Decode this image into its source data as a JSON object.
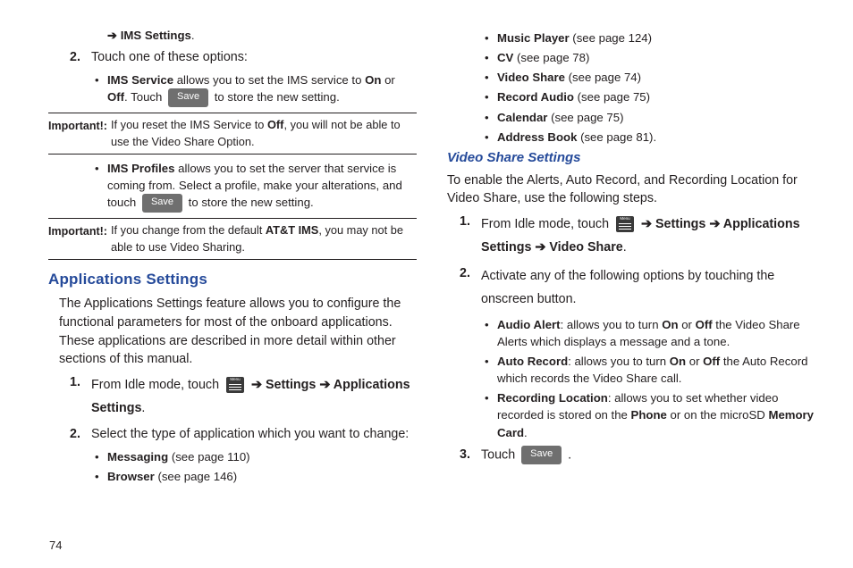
{
  "pageNumber": "74",
  "left": {
    "line1_pre": "➔ ",
    "line1_bold": "IMS Settings",
    "line1_post": ".",
    "step2_num": "2.",
    "step2_text": "Touch one of these options:",
    "b1_a": "IMS Service",
    "b1_b": " allows you to set the IMS service to ",
    "b1_c": "On",
    "b1_d": " or ",
    "b1_e": "Off",
    "b1_f": ". Touch ",
    "b1_save": "Save",
    "b1_g": " to store the new setting.",
    "imp1_label": "Important!:",
    "imp1_a": "If you reset the IMS Service to ",
    "imp1_b": "Off",
    "imp1_c": ", you will not be able to use the Video Share Option.",
    "b2_a": "IMS Profiles",
    "b2_b": " allows you to set the server that service is coming from. Select a profile, make your alterations, and touch ",
    "b2_save": "Save",
    "b2_c": " to store the new setting.",
    "imp2_label": "Important!:",
    "imp2_a": "If you change from the default ",
    "imp2_b": "AT&T IMS",
    "imp2_c": ", you may not be able to use Video Sharing.",
    "appset_head": "Applications Settings",
    "appset_para": "The Applications Settings feature allows you to configure the functional parameters for most of the onboard applications. These applications are described in more detail within other sections of this manual.",
    "as1_num": "1.",
    "as1_a": "From Idle mode, touch ",
    "as1_b": " ➔ ",
    "as1_c": "Settings",
    "as1_d": " ➔ ",
    "as1_e": "Applications Settings",
    "as1_f": ".",
    "as2_num": "2.",
    "as2_text": "Select the type of application which you want to change:",
    "list1_a": "Messaging",
    "list1_b": " (see page 110)",
    "list2_a": "Browser",
    "list2_b": " (see page 146)"
  },
  "right": {
    "list3_a": "Music Player",
    "list3_b": " (see page 124)",
    "list4_a": "CV",
    "list4_b": " (see page 78)",
    "list5_a": "Video Share",
    "list5_b": " (see page 74)",
    "list6_a": "Record Audio",
    "list6_b": " (see page 75)",
    "list7_a": "Calendar",
    "list7_b": " (see page 75)",
    "list8_a": "Address Book",
    "list8_b": " (see page 81).",
    "vss_head": "Video Share Settings",
    "vss_para": "To enable the Alerts, Auto Record, and Recording Location for Video Share, use the following steps.",
    "v1_num": "1.",
    "v1_a": "From Idle mode, touch ",
    "v1_b": " ➔ ",
    "v1_c": "Settings",
    "v1_d": " ➔ ",
    "v1_e": "Applications Settings",
    "v1_f": " ➔ ",
    "v1_g": "Video Share",
    "v1_h": ".",
    "v2_num": "2.",
    "v2_text": "Activate any of the following options by touching the onscreen button.",
    "o1_a": "Audio Alert",
    "o1_b": ": allows you to turn ",
    "o1_c": "On",
    "o1_d": " or ",
    "o1_e": "Off",
    "o1_f": " the Video Share Alerts which displays a message and a tone.",
    "o2_a": "Auto Record",
    "o2_b": ": allows you to turn ",
    "o2_c": "On",
    "o2_d": " or ",
    "o2_e": "Off",
    "o2_f": " the Auto Record which records the Video Share call.",
    "o3_a": "Recording Location",
    "o3_b": ": allows you to set whether video recorded is stored on the ",
    "o3_c": "Phone",
    "o3_d": " or on the microSD ",
    "o3_e": "Memory Card",
    "o3_f": ".",
    "v3_num": "3.",
    "v3_a": "Touch ",
    "v3_save": "Save",
    "v3_b": " ."
  }
}
